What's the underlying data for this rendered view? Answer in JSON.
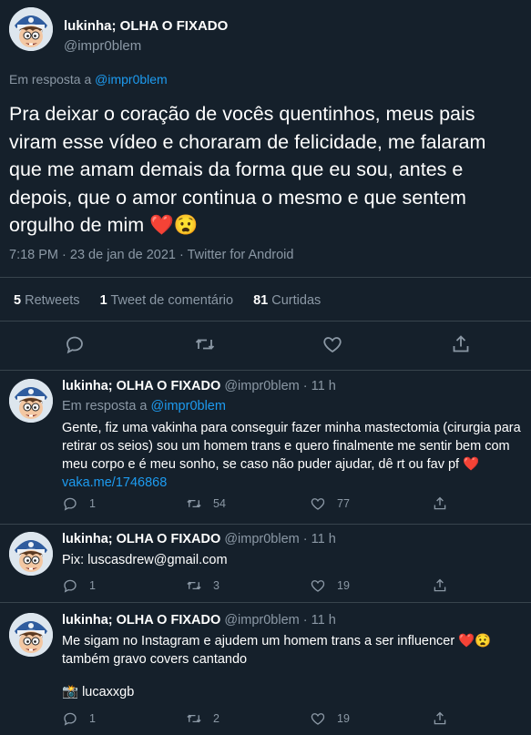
{
  "main_tweet": {
    "display_name": "lukinha; OLHA O FIXADO",
    "handle": "@impr0blem",
    "reply_prefix": "Em resposta a",
    "reply_to": "@impr0blem",
    "text": "Pra deixar o coração de vocês quentinhos, meus pais viram esse vídeo e choraram de felicidade,  me falaram que me amam demais da forma que eu sou, antes e depois, que o amor continua o mesmo e que sentem orgulho de mim ❤️😧",
    "meta": "7:18 PM · 23 de jan de 2021 · Twitter for Android",
    "retweets_count": "5",
    "retweets_label": "Retweets",
    "comments_count": "1",
    "comments_label": "Tweet de comentário",
    "likes_count": "81",
    "likes_label": "Curtidas"
  },
  "replies": [
    {
      "display_name": "lukinha; OLHA O FIXADO",
      "handle": "@impr0blem",
      "time": "· 11 h",
      "reply_prefix": "Em resposta a",
      "reply_to": "@impr0blem",
      "text": "Gente, fiz uma vakinha para conseguir fazer minha mastectomia (cirurgia para retirar os seios) sou um homem trans e quero finalmente me sentir bem com meu corpo e é meu sonho, se caso não puder ajudar, dê rt ou fav pf ❤️",
      "link": "vaka.me/1746868",
      "reply_count": "1",
      "retweet_count": "54",
      "like_count": "77"
    },
    {
      "display_name": "lukinha; OLHA O FIXADO",
      "handle": "@impr0blem",
      "time": "· 11 h",
      "text": "Pix: luscasdrew@gmail.com",
      "reply_count": "1",
      "retweet_count": "3",
      "like_count": "19"
    },
    {
      "display_name": "lukinha; OLHA O FIXADO",
      "handle": "@impr0blem",
      "time": "· 11 h",
      "text_line1": "Me sigam no Instagram e ajudem um homem trans a ser influencer ❤️😧",
      "text_line2": " também gravo covers cantando",
      "instagram": "📸 lucaxxgb",
      "reply_count": "1",
      "retweet_count": "2",
      "like_count": "19"
    }
  ],
  "colors": {
    "background": "#15202b",
    "accent": "#1d9bf0",
    "muted": "#8b98a5",
    "divider": "#38444d"
  },
  "icons": [
    "reply-icon",
    "retweet-icon",
    "like-icon",
    "share-icon"
  ]
}
